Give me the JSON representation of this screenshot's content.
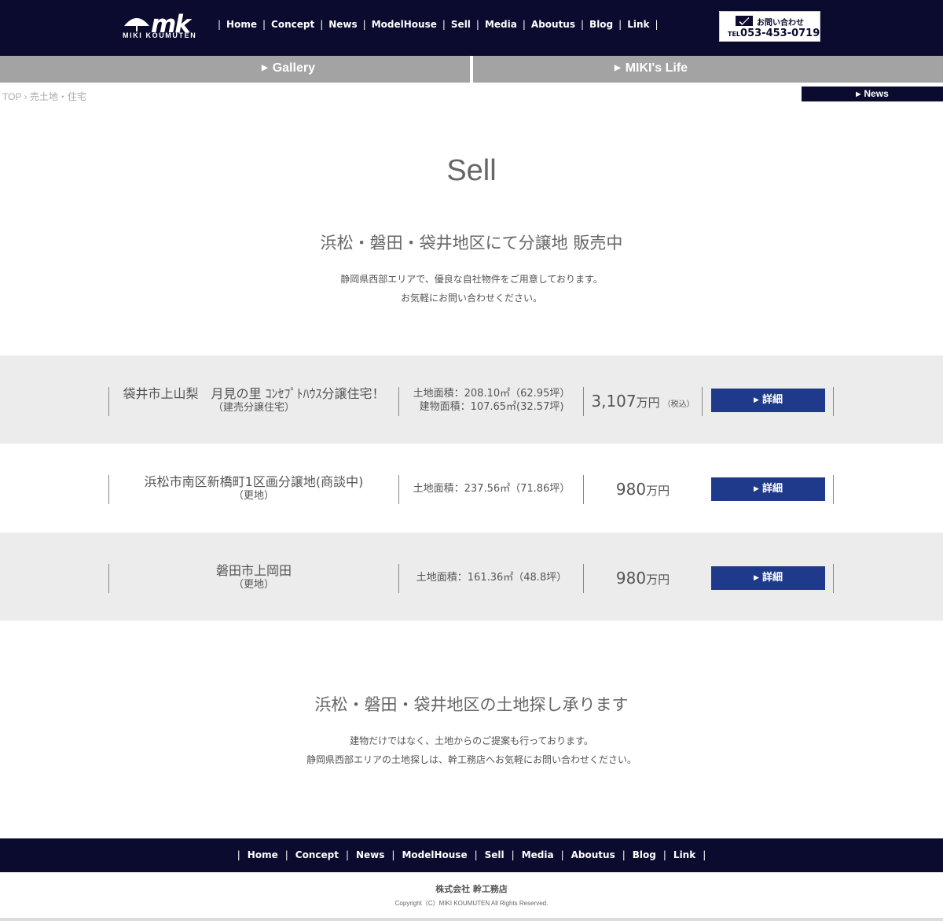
{
  "header": {
    "logo": {
      "mark": "mk",
      "subtitle": "MIKI KOUMUTEN"
    },
    "nav": [
      "Home",
      "Concept",
      "News",
      "ModelHouse",
      "Sell",
      "Media",
      "Aboutus",
      "Blog",
      "Link"
    ],
    "contact": {
      "label": "お問い合わせ",
      "tel_prefix": "TEL",
      "tel": "053-453-0719"
    }
  },
  "subnav": {
    "gallery": "Gallery",
    "life": "MIKI's Life"
  },
  "breadcrumb": {
    "top": "TOP",
    "separator": "›",
    "current": "売土地・住宅"
  },
  "news_button": "News",
  "main": {
    "title": "Sell",
    "heading": "浜松・磐田・袋井地区にて分譲地 販売中",
    "desc_line1": "静岡県西部エリアで、優良な自社物件をご用意しております。",
    "desc_line2": "お気軽にお問い合わせください。"
  },
  "listings": [
    {
      "name": "袋井市上山梨　月見の里 ｺﾝｾﾌﾟﾄﾊｳｽ分譲住宅！",
      "type": "（建売分譲住宅）",
      "area1": "土地面積：208.10㎡（62.95坪）",
      "area2": "建物面積：107.65㎡(32.57坪)",
      "price": "3,107",
      "unit": "万円",
      "tax": "（税込）",
      "button": "詳細"
    },
    {
      "name": "浜松市南区新橋町1区画分譲地(商談中)",
      "type": "（更地）",
      "area1": "土地面積：237.56㎡（71.86坪）",
      "area2": "",
      "price": "980",
      "unit": "万円",
      "tax": "",
      "button": "詳細"
    },
    {
      "name": "磐田市上岡田",
      "type": "（更地）",
      "area1": "土地面積：161.36㎡（48.8坪）",
      "area2": "",
      "price": "980",
      "unit": "万円",
      "tax": "",
      "button": "詳細"
    }
  ],
  "search": {
    "heading": "浜松・磐田・袋井地区の土地探し承ります",
    "desc_line1": "建物だけではなく、土地からのご提案も行っております。",
    "desc_line2": "静岡県西部エリアの土地探しは、幹工務店へお気軽にお問い合わせください。"
  },
  "footer": {
    "nav": [
      "Home",
      "Concept",
      "News",
      "ModelHouse",
      "Sell",
      "Media",
      "Aboutus",
      "Blog",
      "Link"
    ],
    "company": "株式会社 幹工務店",
    "copyright": "Copyright（C）MIKI KOUMUTEN All Rights Reserved."
  },
  "colors": {
    "navy": "#0a0b2e",
    "button": "#1f3a8a",
    "gray_bar": "#a3a3a3",
    "row_bg": "#ececec"
  }
}
